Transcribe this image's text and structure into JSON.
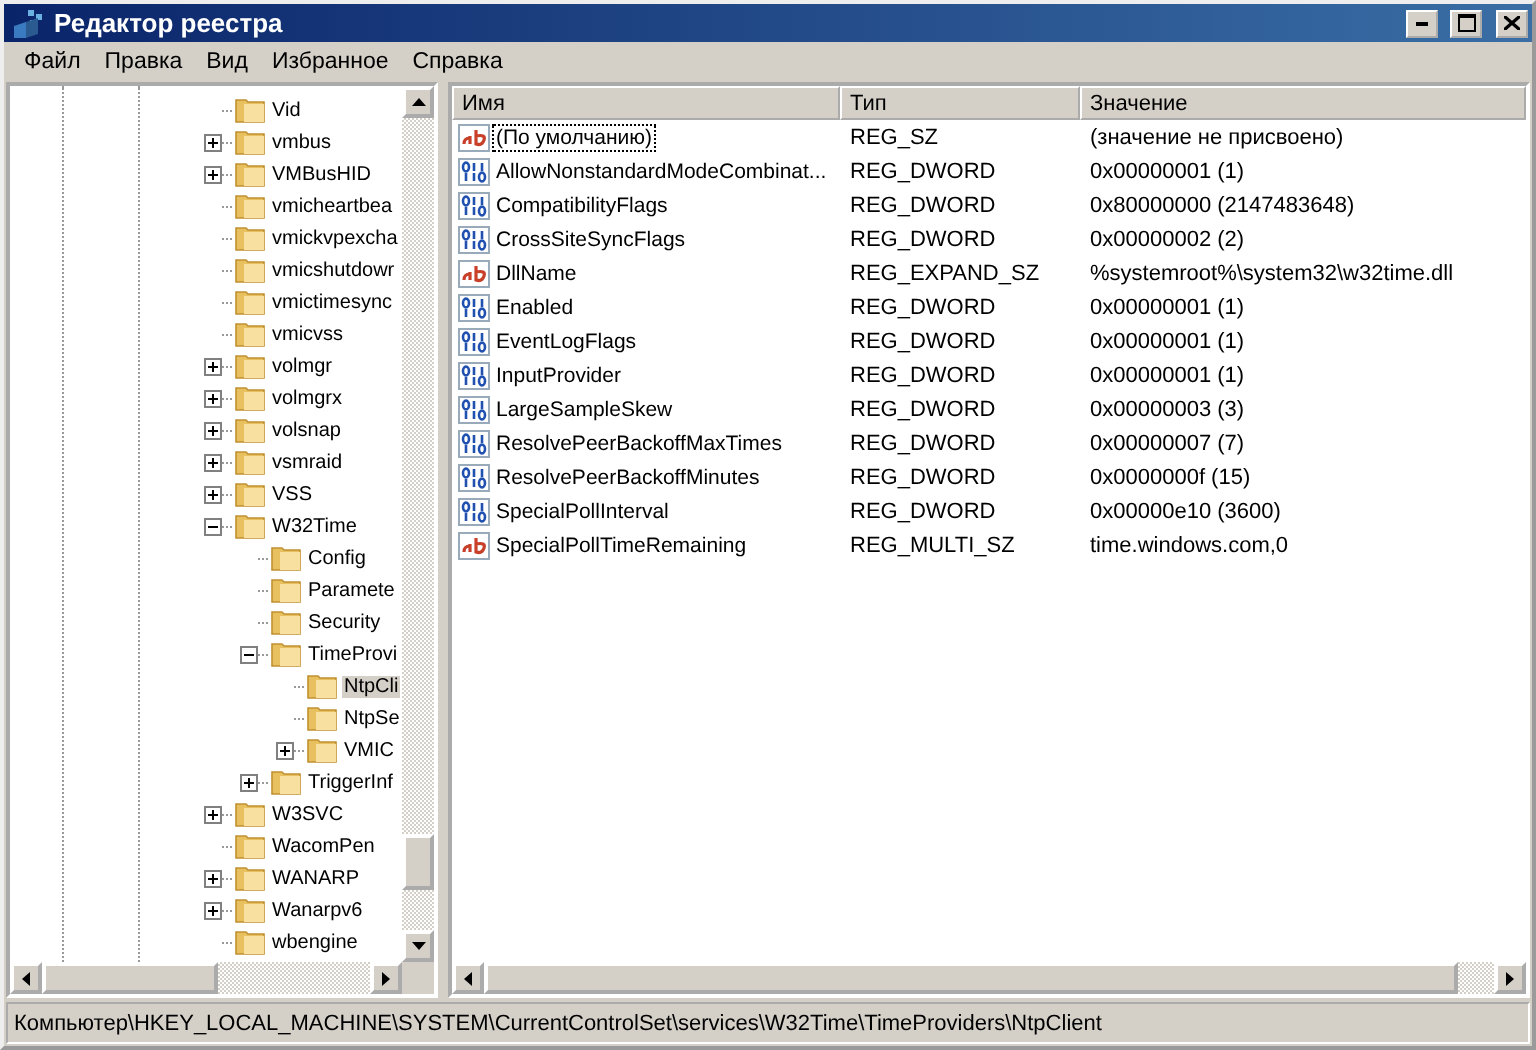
{
  "window": {
    "title": "Редактор реестра"
  },
  "menu": [
    "Файл",
    "Правка",
    "Вид",
    "Избранное",
    "Справка"
  ],
  "tree": [
    {
      "label": "Vid",
      "expandable": false,
      "selected": false
    },
    {
      "label": "vmbus",
      "expandable": true,
      "expanded": false,
      "selected": false
    },
    {
      "label": "VMBusHID",
      "expandable": true,
      "expanded": false,
      "selected": false
    },
    {
      "label": "vmicheartbea",
      "expandable": false,
      "selected": false
    },
    {
      "label": "vmickvpexcha",
      "expandable": false,
      "selected": false
    },
    {
      "label": "vmicshutdowr",
      "expandable": false,
      "selected": false
    },
    {
      "label": "vmictimesync",
      "expandable": false,
      "selected": false
    },
    {
      "label": "vmicvss",
      "expandable": false,
      "selected": false
    },
    {
      "label": "volmgr",
      "expandable": true,
      "expanded": false,
      "selected": false
    },
    {
      "label": "volmgrx",
      "expandable": true,
      "expanded": false,
      "selected": false
    },
    {
      "label": "volsnap",
      "expandable": true,
      "expanded": false,
      "selected": false
    },
    {
      "label": "vsmraid",
      "expandable": true,
      "expanded": false,
      "selected": false
    },
    {
      "label": "VSS",
      "expandable": true,
      "expanded": false,
      "selected": false
    },
    {
      "label": "W32Time",
      "expandable": true,
      "expanded": true,
      "selected": false,
      "children": [
        {
          "label": "Config",
          "expandable": false,
          "selected": false
        },
        {
          "label": "Paramete",
          "expandable": false,
          "selected": false
        },
        {
          "label": "Security",
          "expandable": false,
          "selected": false
        },
        {
          "label": "TimeProvi",
          "expandable": true,
          "expanded": true,
          "selected": false,
          "children": [
            {
              "label": "NtpCli",
              "expandable": false,
              "selected": true
            },
            {
              "label": "NtpSe",
              "expandable": false,
              "selected": false
            },
            {
              "label": "VMIC",
              "expandable": true,
              "expanded": false,
              "selected": false
            }
          ]
        },
        {
          "label": "TriggerInf",
          "expandable": true,
          "expanded": false,
          "selected": false
        }
      ]
    },
    {
      "label": "W3SVC",
      "expandable": true,
      "expanded": false,
      "selected": false
    },
    {
      "label": "WacomPen",
      "expandable": false,
      "selected": false
    },
    {
      "label": "WANARP",
      "expandable": true,
      "expanded": false,
      "selected": false
    },
    {
      "label": "Wanarpv6",
      "expandable": true,
      "expanded": false,
      "selected": false
    },
    {
      "label": "wbengine",
      "expandable": false,
      "selected": false
    }
  ],
  "table": {
    "columns": [
      "Имя",
      "Тип",
      "Значение"
    ],
    "rows": [
      {
        "kind": "string",
        "name": "(По умолчанию)",
        "type": "REG_SZ",
        "value": "(значение не присвоено)",
        "focused": true
      },
      {
        "kind": "binary",
        "name": "AllowNonstandardModeCombinat...",
        "type": "REG_DWORD",
        "value": "0x00000001 (1)",
        "focused": false
      },
      {
        "kind": "binary",
        "name": "CompatibilityFlags",
        "type": "REG_DWORD",
        "value": "0x80000000 (2147483648)",
        "focused": false
      },
      {
        "kind": "binary",
        "name": "CrossSiteSyncFlags",
        "type": "REG_DWORD",
        "value": "0x00000002 (2)",
        "focused": false
      },
      {
        "kind": "string",
        "name": "DllName",
        "type": "REG_EXPAND_SZ",
        "value": "%systemroot%\\system32\\w32time.dll",
        "focused": false
      },
      {
        "kind": "binary",
        "name": "Enabled",
        "type": "REG_DWORD",
        "value": "0x00000001 (1)",
        "focused": false
      },
      {
        "kind": "binary",
        "name": "EventLogFlags",
        "type": "REG_DWORD",
        "value": "0x00000001 (1)",
        "focused": false
      },
      {
        "kind": "binary",
        "name": "InputProvider",
        "type": "REG_DWORD",
        "value": "0x00000001 (1)",
        "focused": false
      },
      {
        "kind": "binary",
        "name": "LargeSampleSkew",
        "type": "REG_DWORD",
        "value": "0x00000003 (3)",
        "focused": false
      },
      {
        "kind": "binary",
        "name": "ResolvePeerBackoffMaxTimes",
        "type": "REG_DWORD",
        "value": "0x00000007 (7)",
        "focused": false
      },
      {
        "kind": "binary",
        "name": "ResolvePeerBackoffMinutes",
        "type": "REG_DWORD",
        "value": "0x0000000f (15)",
        "focused": false
      },
      {
        "kind": "binary",
        "name": "SpecialPollInterval",
        "type": "REG_DWORD",
        "value": "0x00000e10 (3600)",
        "focused": false
      },
      {
        "kind": "string",
        "name": "SpecialPollTimeRemaining",
        "type": "REG_MULTI_SZ",
        "value": "time.windows.com,0",
        "focused": false
      }
    ]
  },
  "status_bar": "Компьютер\\HKEY_LOCAL_MACHINE\\SYSTEM\\CurrentControlSet\\services\\W32Time\\TimeProviders\\NtpClient"
}
